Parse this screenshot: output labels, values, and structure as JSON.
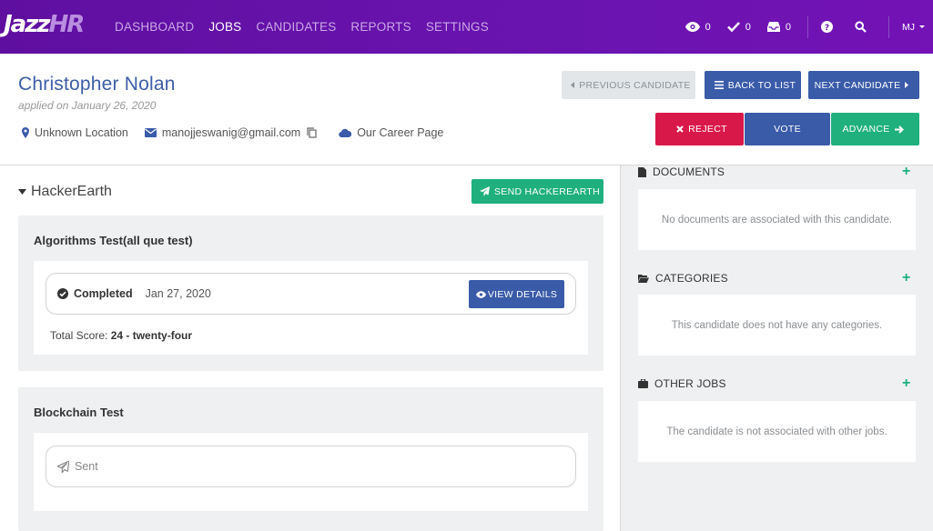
{
  "nav": {
    "logo_main": "Jazz",
    "logo_accent": "HR",
    "menu": [
      "DASHBOARD",
      "JOBS",
      "CANDIDATES",
      "REPORTS",
      "SETTINGS"
    ],
    "active_index": 1,
    "counts": {
      "views": "0",
      "checks": "0",
      "inbox": "0"
    },
    "user_initials": "MJ"
  },
  "candidate": {
    "name": "Christopher Nolan",
    "applied": "applied on January 26, 2020",
    "location": "Unknown Location",
    "email": "manojjeswanig@gmail.com",
    "source": "Our Career Page"
  },
  "actions": {
    "previous": "PREVIOUS CANDIDATE",
    "back": "BACK TO LIST",
    "next": "NEXT CANDIDATE",
    "reject": "REJECT",
    "vote": "VOTE",
    "advance": "ADVANCE"
  },
  "hackerearth": {
    "title": "HackerEarth",
    "send_label": "SEND HACKEREARTH",
    "tests": [
      {
        "name": "Algorithms Test(all que test)",
        "status": "Completed",
        "date": "Jan 27, 2020",
        "view_label": "VIEW DETAILS",
        "score_label": "Total Score:",
        "score_value": "24 - twenty-four"
      },
      {
        "name": "Blockchain Test",
        "status": "Sent"
      }
    ]
  },
  "sidebar": {
    "documents": {
      "title": "DOCUMENTS",
      "empty": "No documents are associated with this candidate."
    },
    "categories": {
      "title": "CATEGORIES",
      "empty": "This candidate does not have any categories."
    },
    "other_jobs": {
      "title": "OTHER JOBS",
      "empty": "The candidate is not associated with other jobs."
    }
  },
  "colors": {
    "brand": "#6a14b0",
    "primary": "#3a5ba8",
    "danger": "#d9184a",
    "success": "#1fb07e"
  }
}
